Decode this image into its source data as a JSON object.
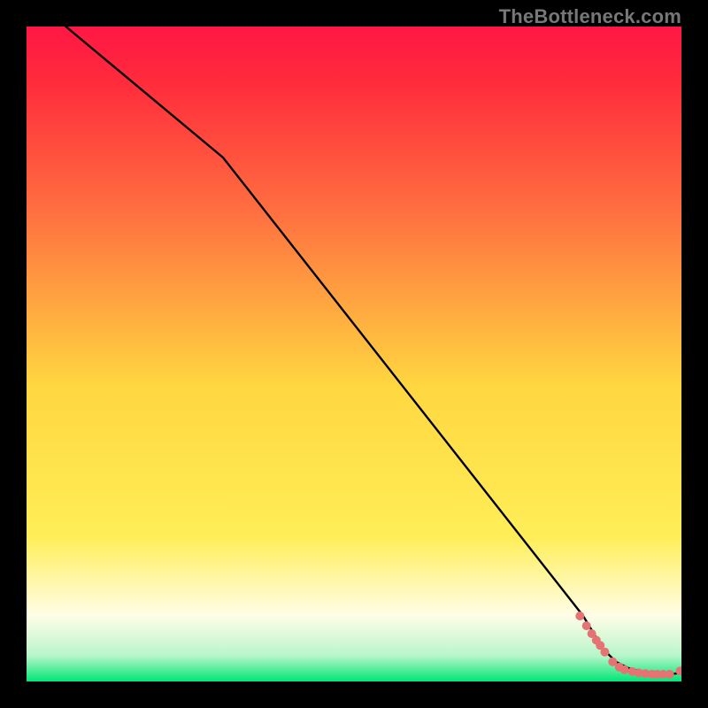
{
  "watermark": "TheBottleneck.com",
  "colors": {
    "frame": "#000000",
    "line": "#000000",
    "dot": "#E57373",
    "gradient_top": "#FF1744",
    "gradient_upper_mid": "#FF6E40",
    "gradient_mid": "#FFD740",
    "gradient_lower_mid": "#FFEE58",
    "gradient_pale_band": "#FFFDE7",
    "gradient_green": "#00E676"
  },
  "chart_data": {
    "type": "line",
    "title": "",
    "xlabel": "",
    "ylabel": "",
    "xlim": [
      0,
      100
    ],
    "ylim": [
      0,
      100
    ],
    "grid": false,
    "legend": false,
    "series": [
      {
        "name": "curve",
        "x": [
          6,
          30,
          85,
          88,
          90,
          92,
          94,
          96,
          98,
          100
        ],
        "y": [
          100,
          80,
          10,
          5,
          3,
          2,
          1.5,
          1.2,
          1.1,
          1.3
        ]
      }
    ],
    "points": {
      "name": "dots",
      "x": [
        84.5,
        85.5,
        86.3,
        87.0,
        87.6,
        88.3,
        89.5,
        90.5,
        91.3,
        92.5,
        93.5,
        94.5,
        95.5,
        96.3,
        97.2,
        98.2,
        99.8
      ],
      "y": [
        10.0,
        8.5,
        7.3,
        6.3,
        5.5,
        4.5,
        3.0,
        2.2,
        1.8,
        1.5,
        1.3,
        1.2,
        1.1,
        1.1,
        1.1,
        1.1,
        1.6
      ]
    }
  }
}
